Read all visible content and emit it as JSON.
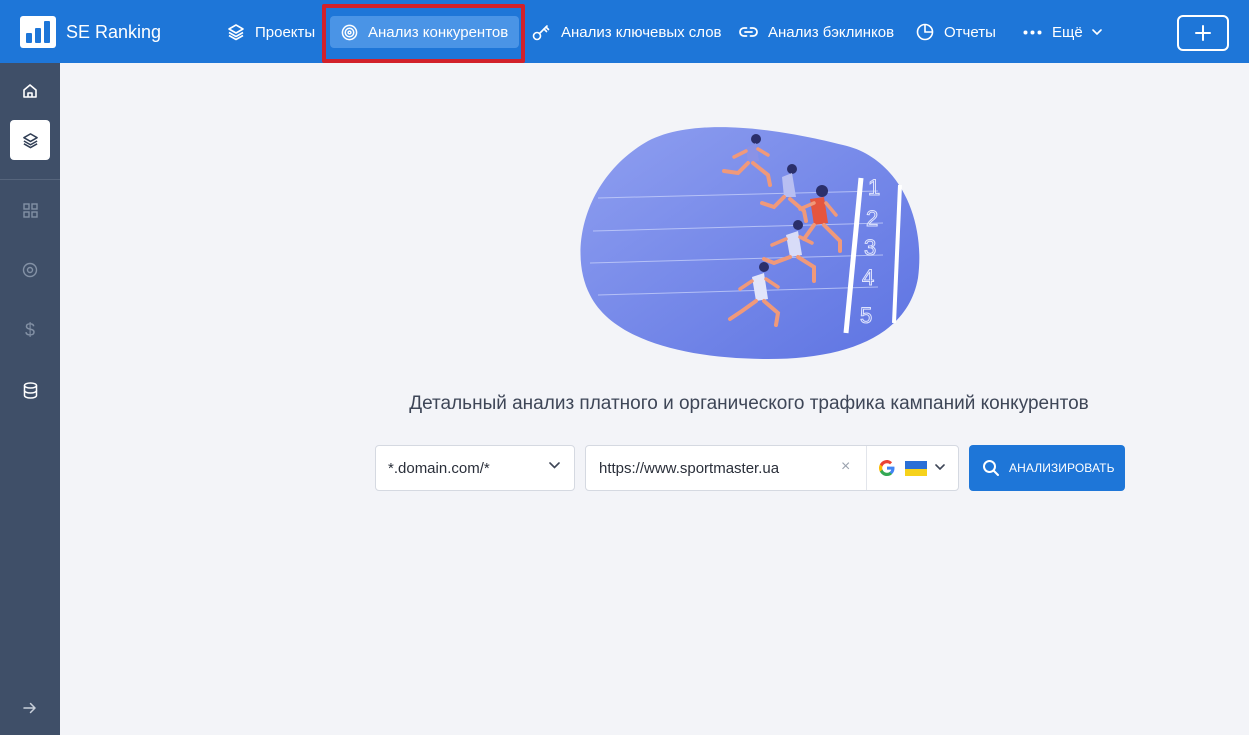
{
  "app": {
    "name": "SE Ranking"
  },
  "nav": [
    {
      "label": "Проекты",
      "icon": "layers-icon"
    },
    {
      "label": "Анализ конкурентов",
      "icon": "target-icon",
      "active": true
    },
    {
      "label": "Анализ ключевых слов",
      "icon": "key-icon"
    },
    {
      "label": "Анализ бэклинков",
      "icon": "link-icon"
    },
    {
      "label": "Отчеты",
      "icon": "pie-chart-icon"
    },
    {
      "label": "Ещё",
      "icon": "more-dots-icon"
    }
  ],
  "sidebar": {
    "items": [
      "home-icon",
      "layers-icon",
      "grid-icon",
      "target-icon",
      "dollar-icon",
      "database-icon",
      "arrow-right-icon"
    ],
    "dollar_glyph": "$"
  },
  "main": {
    "headline": "Детальный анализ платного и органического трафика кампаний конкурентов",
    "scope_select": "*.domain.com/*",
    "url_value": "https://www.sportmaster.ua",
    "clear_glyph": "×",
    "search_engine_icon": "google-icon",
    "region_flag": "ukraine-flag-icon",
    "analyze_label": "АНАЛИЗИРОВАТЬ"
  },
  "track_lane_numbers": [
    "1",
    "2",
    "3",
    "4",
    "5"
  ],
  "colors": {
    "primary": "#1e76d8",
    "sidebar": "#3f4f68",
    "highlight": "#d2212b",
    "background": "#f3f4f8"
  }
}
